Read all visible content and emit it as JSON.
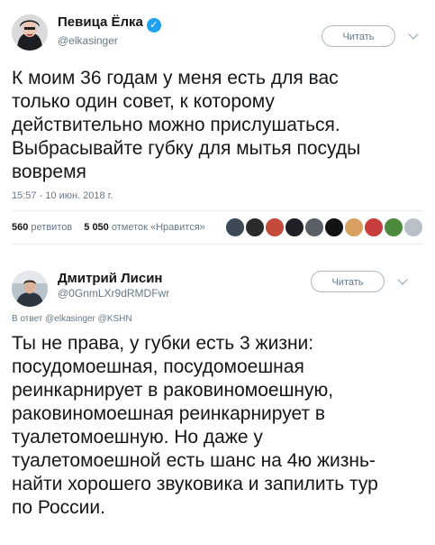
{
  "tweet1": {
    "name": "Певица Ёлка",
    "handle": "@elkasinger",
    "follow_label": "Читать",
    "text": "К моим 36 годам у меня есть для вас\nтолько один совет, к которому\nдействительно можно прислушаться.\nВыбрасывайте губку для мытья посуды\nвовремя",
    "timestamp": "15:57 - 10 июн. 2018 г.",
    "retweets_count": "560",
    "retweets_label": "ретвитов",
    "likes_count": "5 050",
    "likes_label": "отметок «Нравится»"
  },
  "tweet2": {
    "name": "Дмитрий Лисин",
    "handle": "@0GnmLXr9dRMDFwr",
    "follow_label": "Читать",
    "reply_to": "В ответ @elkasinger @KSHN",
    "text": "Ты не права, у губки есть 3 жизни:\nпосудомоешная, посудомоешная\nреинкарнирует в раковиномоешную,\nраковиномоешная реинкарнирует в\nтуалетомоешную. Но даже у\nтуалетомоешной есть шанс на 4ю жизнь-\nнайти хорошего звуковика и запилить тур\nпо России."
  },
  "colors": {
    "verified": "#1da1f2",
    "secondary_text": "#657786",
    "divider": "#e6ecf0"
  }
}
